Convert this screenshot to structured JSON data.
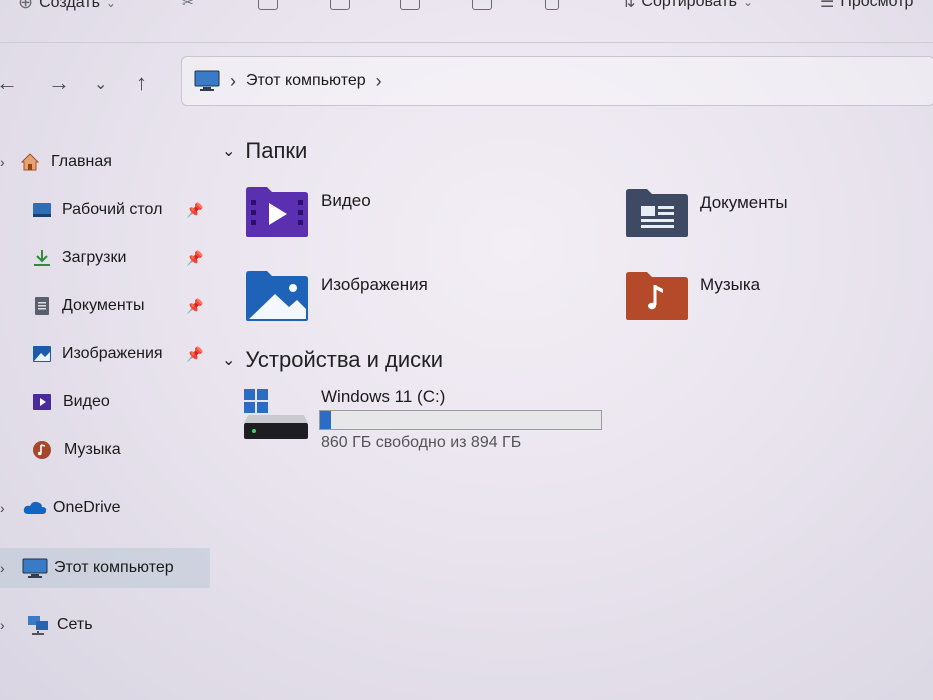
{
  "toolbar": {
    "create_label": "Создать",
    "sort_label": "Сортировать",
    "view_label": "Просмотр"
  },
  "address_bar": {
    "crumbs": [
      "Этот компьютер"
    ]
  },
  "sidebar": {
    "items": [
      {
        "label": "Главная",
        "icon": "home-icon"
      },
      {
        "label": "Рабочий стол",
        "icon": "desktop-icon",
        "pinned": true
      },
      {
        "label": "Загрузки",
        "icon": "download-icon",
        "pinned": true
      },
      {
        "label": "Документы",
        "icon": "documents-icon",
        "pinned": true
      },
      {
        "label": "Изображения",
        "icon": "pictures-icon",
        "pinned": true
      },
      {
        "label": "Видео",
        "icon": "video-icon"
      },
      {
        "label": "Музыка",
        "icon": "music-icon"
      },
      {
        "label": "OneDrive",
        "icon": "cloud-icon"
      },
      {
        "label": "Этот компьютер",
        "icon": "computer-icon",
        "selected": true
      },
      {
        "label": "Сеть",
        "icon": "network-icon"
      }
    ]
  },
  "main": {
    "folders_header": "Папки",
    "folders": [
      {
        "label": "Видео",
        "icon": "video-folder-icon",
        "color": "#5a2fb0"
      },
      {
        "label": "Документы",
        "icon": "documents-folder-icon",
        "color": "#3e4a63"
      },
      {
        "label": "Изображения",
        "icon": "pictures-folder-icon",
        "color": "#1f63b8"
      },
      {
        "label": "Музыка",
        "icon": "music-folder-icon",
        "color": "#b54a2a"
      }
    ],
    "devices_header": "Устройства и диски",
    "drive": {
      "label": "Windows 11 (C:)",
      "free_text": "860 ГБ свободно из 894 ГБ",
      "used_fraction": 0.038
    }
  }
}
